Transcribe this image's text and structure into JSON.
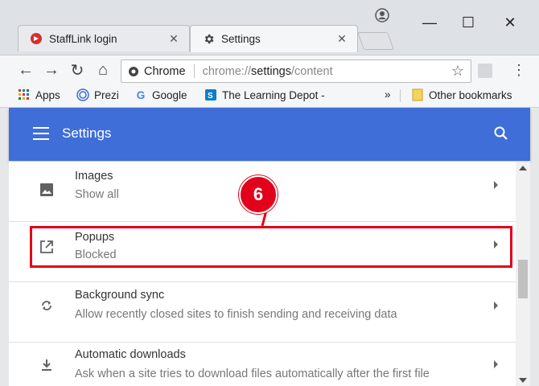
{
  "browser": {
    "tabs": [
      {
        "label": "StaffLink login",
        "icon": "stafflink-logo-icon",
        "active": false
      },
      {
        "label": "Settings",
        "icon": "gear-icon",
        "active": true
      }
    ],
    "omnibox": {
      "chip_label": "Chrome",
      "url_prefix": "chrome://",
      "url_bold": "settings",
      "url_suffix": "/content"
    },
    "bookmarks": [
      {
        "label": "Apps",
        "icon": "apps-grid-icon"
      },
      {
        "label": "Prezi",
        "icon": "prezi-icon"
      },
      {
        "label": "Google",
        "icon": "google-icon"
      },
      {
        "label": "The Learning Depot -",
        "icon": "sharepoint-icon"
      }
    ],
    "overflow_label": "»",
    "other_bookmarks_label": "Other bookmarks"
  },
  "settings": {
    "header_title": "Settings",
    "rows": [
      {
        "title": "Images",
        "subtitle": "Show all",
        "icon": "image-icon"
      },
      {
        "title": "Popups",
        "subtitle": "Blocked",
        "icon": "open-in-new-icon"
      },
      {
        "title": "Background sync",
        "subtitle": "Allow recently closed sites to finish sending and receiving data",
        "icon": "sync-icon"
      },
      {
        "title": "Automatic downloads",
        "subtitle": "Ask when a site tries to download files automatically after the first file",
        "icon": "download-icon"
      }
    ]
  },
  "annotation": {
    "step_number": "6",
    "color": "#e2001a"
  },
  "colors": {
    "header_blue": "#3f6ed8"
  }
}
